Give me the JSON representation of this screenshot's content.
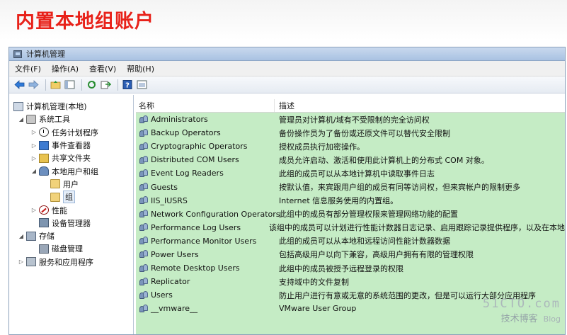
{
  "slide": {
    "title": "内置本地组账户"
  },
  "window": {
    "title": "计算机管理"
  },
  "menu": [
    "文件(F)",
    "操作(A)",
    "查看(V)",
    "帮助(H)"
  ],
  "toolbar": {
    "icons": [
      "back-icon",
      "forward-icon",
      "up-folder-icon",
      "show-hide-tree-icon",
      "refresh-icon",
      "export-icon",
      "help-icon",
      "properties-icon"
    ]
  },
  "tree": {
    "root": "计算机管理(本地)",
    "items": [
      {
        "label": "系统工具"
      },
      {
        "label": "任务计划程序"
      },
      {
        "label": "事件查看器"
      },
      {
        "label": "共享文件夹"
      },
      {
        "label": "本地用户和组"
      },
      {
        "label": "用户"
      },
      {
        "label": "组"
      },
      {
        "label": "性能"
      },
      {
        "label": "设备管理器"
      },
      {
        "label": "存储"
      },
      {
        "label": "磁盘管理"
      },
      {
        "label": "服务和应用程序"
      }
    ]
  },
  "list": {
    "columns": {
      "name": "名称",
      "desc": "描述"
    },
    "rows": [
      {
        "name": "Administrators",
        "desc": "管理员对计算机/域有不受限制的完全访问权"
      },
      {
        "name": "Backup Operators",
        "desc": "备份操作员为了备份或还原文件可以替代安全限制"
      },
      {
        "name": "Cryptographic Operators",
        "desc": "授权成员执行加密操作。"
      },
      {
        "name": "Distributed COM Users",
        "desc": "成员允许启动、激活和使用此计算机上的分布式 COM 对象。"
      },
      {
        "name": "Event Log Readers",
        "desc": "此组的成员可以从本地计算机中读取事件日志"
      },
      {
        "name": "Guests",
        "desc": "按默认值，来宾跟用户组的成员有同等访问权，但来宾帐户的限制更多"
      },
      {
        "name": "IIS_IUSRS",
        "desc": "Internet 信息服务使用的内置组。"
      },
      {
        "name": "Network Configuration Operators",
        "desc": "此组中的成员有部分管理权限来管理网络功能的配置"
      },
      {
        "name": "Performance Log Users",
        "desc": "该组中的成员可以计划进行性能计数器日志记录、启用跟踪记录提供程序，以及在本地"
      },
      {
        "name": "Performance Monitor Users",
        "desc": "此组的成员可以从本地和远程访问性能计数器数据"
      },
      {
        "name": "Power Users",
        "desc": "包括高级用户以向下兼容，高级用户拥有有限的管理权限"
      },
      {
        "name": "Remote Desktop Users",
        "desc": "此组中的成员被授予远程登录的权限"
      },
      {
        "name": "Replicator",
        "desc": "支持域中的文件复制"
      },
      {
        "name": "Users",
        "desc": "防止用户进行有意或无意的系统范围的更改，但是可以运行大部分应用程序"
      },
      {
        "name": "__vmware__",
        "desc": "VMware User Group"
      }
    ]
  },
  "watermark": {
    "site": "51CTO.com",
    "sub": "技术博客",
    "blog": "Blog"
  },
  "colors": {
    "title_red": "#e8221a",
    "list_bg": "#c5ecc5"
  }
}
